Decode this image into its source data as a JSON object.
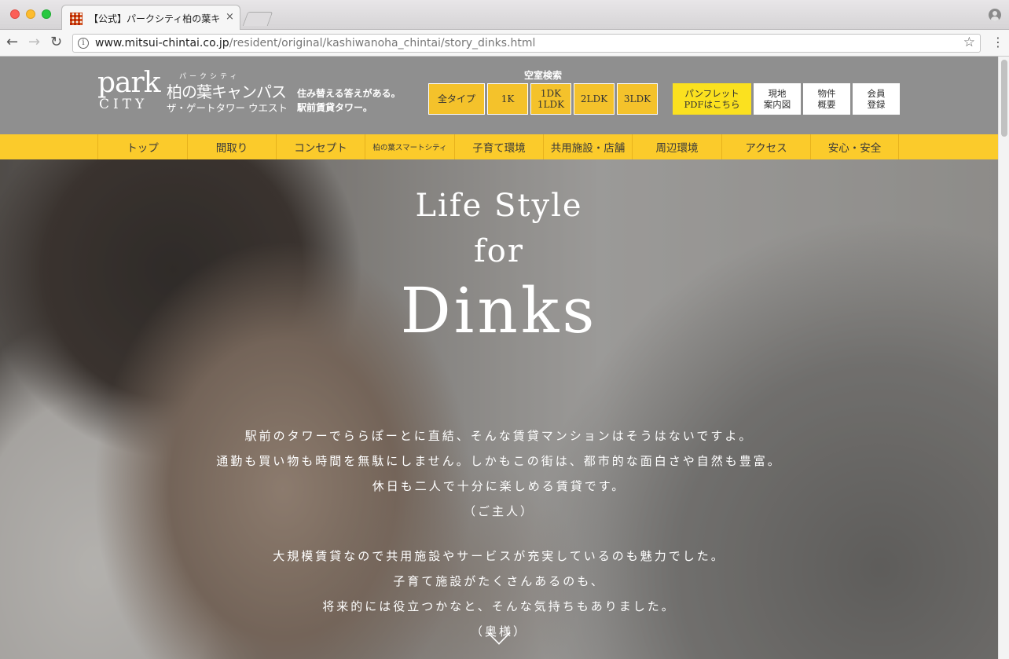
{
  "browser": {
    "tab_title": "【公式】パークシティ柏の葉キャンパス",
    "tab_close": "×",
    "url_host": "www.mitsui-chintai.co.jp",
    "url_path": "/resident/original/kashiwanoha_chintai/story_dinks.html",
    "back": "←",
    "forward": "→",
    "reload": "↻",
    "star": "☆",
    "menu": "⋮",
    "info": "i"
  },
  "header": {
    "logo": {
      "park": "park",
      "city": "CITY",
      "kana": "パークシティ",
      "name": "柏の葉キャンパス",
      "sub": "ザ・ゲートタワー ウエスト"
    },
    "tagline_1": "住み替える答えがある。",
    "tagline_2": "駅前賃貸タワー。",
    "search_title": "空室検索",
    "type_buttons": [
      "全タイプ",
      "1K",
      "1DK\n1LDK",
      "2LDK",
      "3LDK"
    ],
    "side_buttons": [
      "パンフレット\nPDFはこちら",
      "現地\n案内図",
      "物件\n概要",
      "会員\n登録"
    ]
  },
  "nav": [
    "トップ",
    "間取り",
    "コンセプト",
    "柏の葉スマートシティ",
    "子育て環境",
    "共用施設・店舗",
    "周辺環境",
    "アクセス",
    "安心・安全"
  ],
  "hero": {
    "title_1": "Life Style",
    "title_2": "for",
    "title_3": "Dinks",
    "husband_lines": [
      "駅前のタワーでららぽーとに直結、そんな賃貸マンションはそうはないですよ。",
      "通勤も買い物も時間を無駄にしません。しかもこの街は、都市的な面白さや自然も豊富。",
      "休日も二人で十分に楽しめる賃貸です。",
      "（ご主人）"
    ],
    "wife_lines": [
      "大規模賃貸なので共用施設やサービスが充実しているのも魅力でした。",
      "子育て施設がたくさんあるのも、",
      "将来的には役立つかなと、そんな気持ちもありました。",
      "（奥様）"
    ]
  },
  "colors": {
    "header_bg": "#8f8f8f",
    "nav_bg": "#fbcb2b",
    "type_button": "#f4c22b",
    "pamphlet_button": "#fbe11f"
  }
}
